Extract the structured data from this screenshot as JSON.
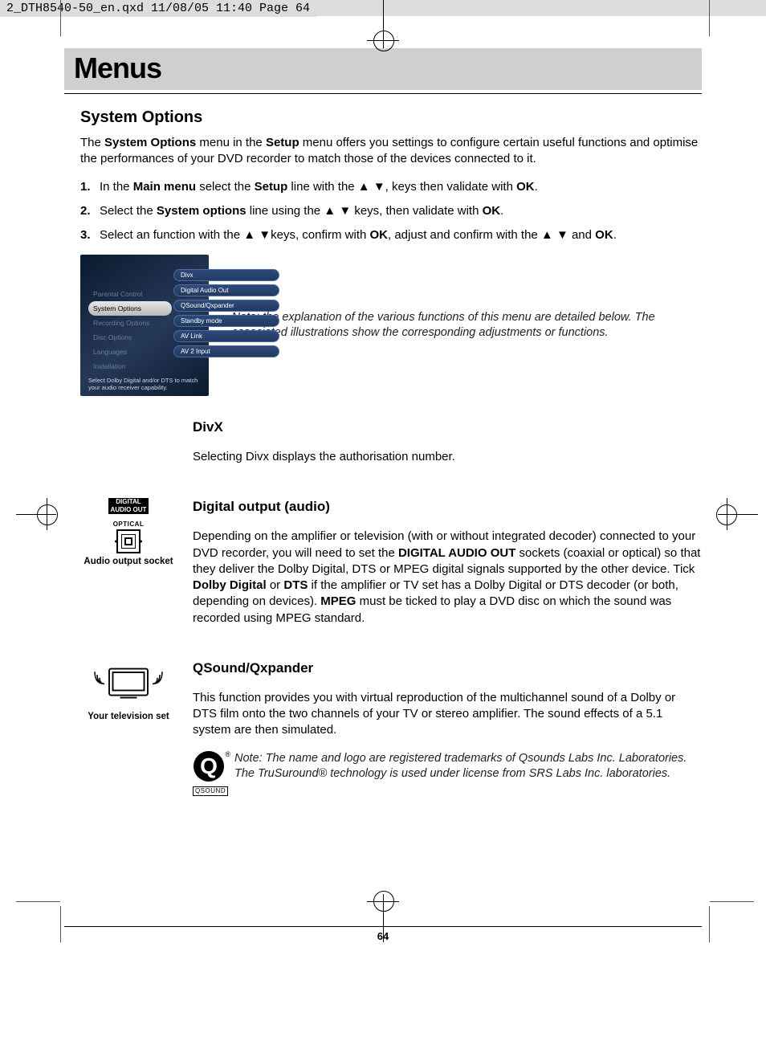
{
  "slug": "2_DTH8540-50_en.qxd  11/08/05  11:40  Page 64",
  "chapter_title": "Menus",
  "section_title": "System Options",
  "intro_parts": {
    "p1": "The ",
    "b1": "System Options",
    "p2": " menu in the ",
    "b2": "Setup",
    "p3": " menu offers you settings to configure certain useful functions and optimise the performances of your DVD recorder to match those of the devices connected to it."
  },
  "steps": {
    "s1": {
      "num": "1.",
      "a": "In the ",
      "b1": "Main menu",
      "c": " select the ",
      "b2": "Setup",
      "d": " line with the ▲ ▼, keys then validate with ",
      "b3": "OK",
      "e": "."
    },
    "s2": {
      "num": "2.",
      "a": "Select the ",
      "b1": "System options",
      "c": " line using the ▲ ▼ keys, then validate with ",
      "b2": "OK",
      "d": "."
    },
    "s3": {
      "num": "3.",
      "a": "Select an function with the ▲ ▼keys, confirm with ",
      "b1": "OK",
      "c": ", adjust and confirm with the ▲ ▼ and ",
      "b2": "OK",
      "d": "."
    }
  },
  "osd": {
    "sidebar": [
      "Parental Control",
      "System Options",
      "Recording Options",
      "Disc Options",
      "Languages",
      "Installation"
    ],
    "options": [
      "Divx",
      "Digital Audio Out",
      "QSound/Qxpander",
      "Standby mode",
      "AV Link",
      "AV 2 Input"
    ],
    "hint": "Select Dolby Digital and/or DTS to match your audio receiver capability."
  },
  "osd_note": "Note: the explanation of the various functions of this menu are detailed below. The associated illustrations show the corresponding adjustments or functions.",
  "divx": {
    "heading": "DivX",
    "body": "Selecting Divx displays the authorisation number."
  },
  "digital_out": {
    "heading": "Digital output (audio)",
    "icon_label_top1": "DIGITAL",
    "icon_label_top2": "AUDIO OUT",
    "icon_label_mid": "OPTICAL",
    "caption": "Audio output socket",
    "body": {
      "a": "Depending on the amplifier or television (with or without integrated decoder) connected to your DVD recorder, you will need to set the ",
      "b1": "DIGITAL AUDIO OUT",
      "c": " sockets (coaxial or optical) so that they deliver the Dolby Digital, DTS or MPEG digital signals supported by the other device. Tick ",
      "b2": "Dolby Digital",
      "d": " or ",
      "b3": "DTS",
      "e": " if the amplifier or TV set has a Dolby Digital or DTS decoder (or both, depending on devices). ",
      "b4": "MPEG",
      "f": " must be ticked to play a DVD disc on which the sound was recorded using MPEG standard."
    }
  },
  "qsound": {
    "heading": "QSound/Qxpander",
    "caption": "Your television set",
    "body": "This function provides you with virtual reproduction of the multichannel sound of a Dolby or DTS film onto the two channels of your TV or stereo amplifier. The sound effects of a 5.1 system are then simulated.",
    "qlogo_label": "QSOUND",
    "note": "Note: The name and logo are registered trademarks of Qsounds Labs Inc. Laboratories. The TruSuround® technology is used under license from SRS Labs Inc. laboratories."
  },
  "page_number": "64"
}
